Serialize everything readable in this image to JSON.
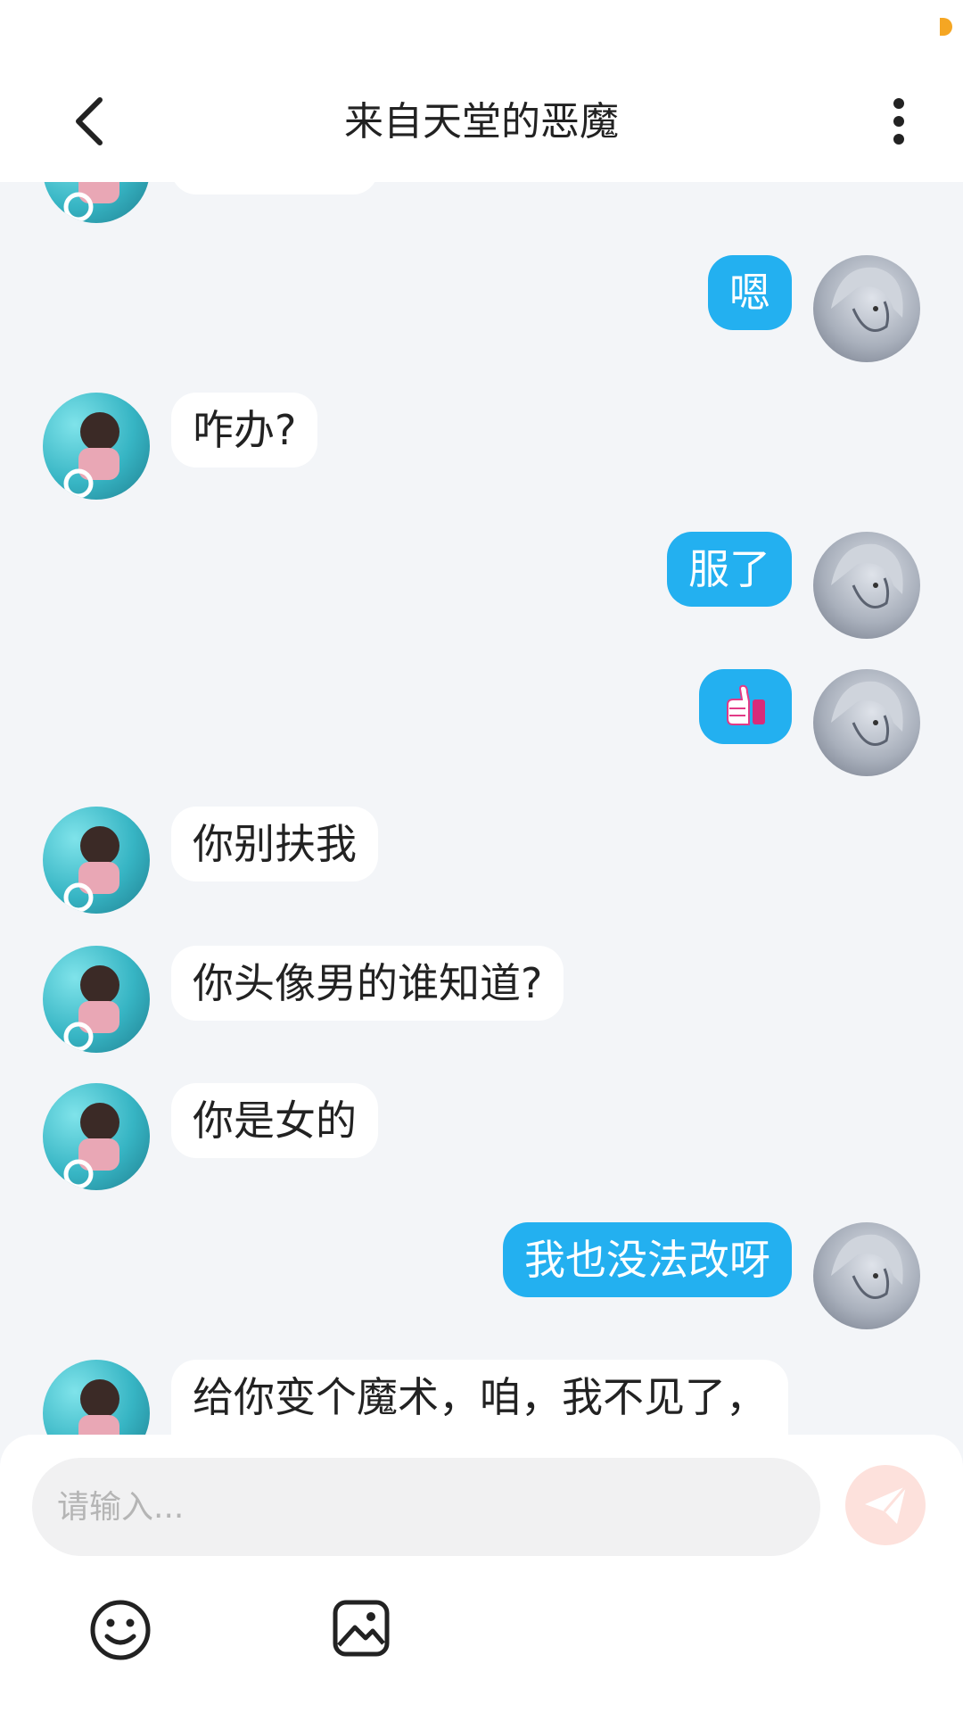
{
  "header": {
    "title": "来自天堂的恶魔"
  },
  "icons": {
    "back": "chevron-left-icon",
    "more": "more-vertical-icon",
    "send": "paper-plane-icon",
    "emoji": "smile-icon",
    "image": "image-icon",
    "thumbs_up": "thumbs-up-emoji"
  },
  "colors": {
    "accent_blue": "#23b0f0",
    "background": "#f3f5f8",
    "send_button": "#fde1dc"
  },
  "messages": [
    {
      "side": "left",
      "text": ""
    },
    {
      "side": "right",
      "text": "嗯"
    },
    {
      "side": "left",
      "text": "咋办?"
    },
    {
      "side": "right",
      "text": "服了"
    },
    {
      "side": "right",
      "text": "",
      "emoji": "thumbs-up"
    },
    {
      "side": "left",
      "text": "你别扶我"
    },
    {
      "side": "left",
      "text": "你头像男的谁知道?"
    },
    {
      "side": "left",
      "text": "你是女的"
    },
    {
      "side": "right",
      "text": "我也没法改呀"
    },
    {
      "side": "left",
      "text": "给你变个魔术，咱，我不见了，"
    }
  ],
  "input": {
    "placeholder": "请输入..."
  }
}
